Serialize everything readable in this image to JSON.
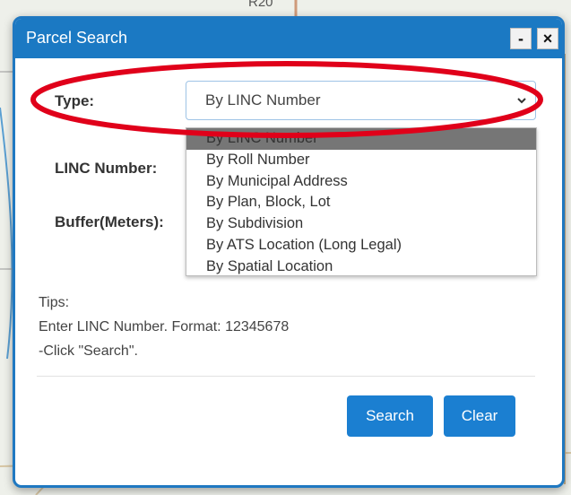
{
  "dialog": {
    "title": "Parcel Search",
    "minimize_label": "-",
    "close_label": "×"
  },
  "form": {
    "type_label": "Type:",
    "type_selected": "By LINC Number",
    "linc_label": "LINC Number:",
    "buffer_label": "Buffer(Meters):"
  },
  "dropdown": {
    "options": [
      "By LINC Number",
      "By Roll Number",
      "By Municipal Address",
      "By Plan, Block, Lot",
      "By Subdivision",
      "By ATS Location (Long Legal)",
      "By Spatial Location"
    ]
  },
  "tips": {
    "heading": "Tips:",
    "line1": "Enter LINC Number. Format: 12345678",
    "line2": "-Click \"Search\"."
  },
  "buttons": {
    "search": "Search",
    "clear": "Clear"
  },
  "background_text": {
    "road_label": "R20"
  },
  "colors": {
    "titlebar": "#1b79c3",
    "button": "#1b7fd1",
    "highlight_ring": "#e0001a"
  },
  "icons": {
    "chevron": "chevron-down-icon",
    "minimize": "minimize-icon",
    "close": "close-icon"
  }
}
